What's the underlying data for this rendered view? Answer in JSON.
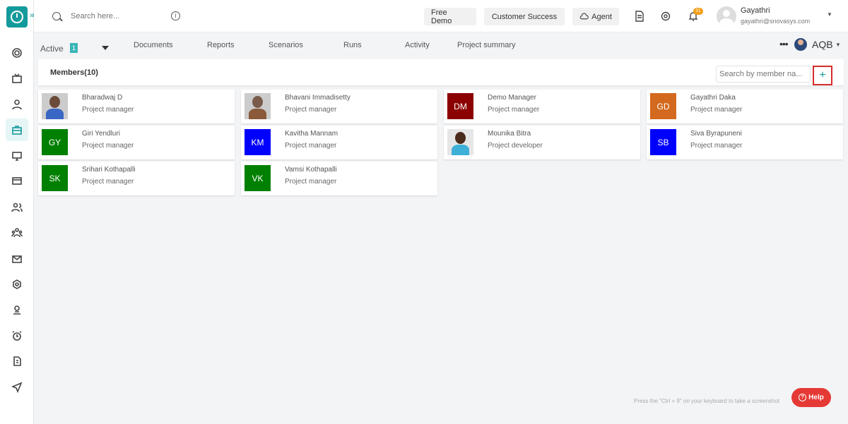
{
  "topbar": {
    "search_placeholder": "Search here...",
    "info_glyph": "i",
    "free_demo": "Free Demo",
    "customer_success": "Customer Success",
    "agent": "Agent",
    "notification_count": "31",
    "user_name": "Gayathri",
    "user_email": "gayathri@snovasys.com"
  },
  "sidebar": {
    "icons": [
      "dashboard-icon",
      "tv-icon",
      "user-icon",
      "briefcase-icon",
      "monitor-icon",
      "card-icon",
      "users-icon",
      "team-icon",
      "mail-icon",
      "settings-icon",
      "profile-icon",
      "alarm-icon",
      "invoice-icon",
      "send-icon"
    ],
    "active": "briefcase-icon"
  },
  "tabs": {
    "status_label": "Active",
    "status_count": "1",
    "items": [
      "Documents",
      "Reports",
      "Scenarios",
      "Runs",
      "Activity",
      "Project summary"
    ],
    "more": "•••",
    "project_code": "AQB"
  },
  "members": {
    "title": "Members(10)",
    "search_placeholder": "Search by member na...",
    "add_label": "+",
    "list": [
      {
        "name": "Bharadwaj D",
        "role": "Project manager",
        "initials": "",
        "color": "",
        "photo": "p1"
      },
      {
        "name": "Bhavani Immadisetty",
        "role": "Project manager",
        "initials": "",
        "color": "",
        "photo": "p2"
      },
      {
        "name": "Demo Manager",
        "role": "Project manager",
        "initials": "DM",
        "color": "#8b0000"
      },
      {
        "name": "Gayathri Daka",
        "role": "Project manager",
        "initials": "GD",
        "color": "#d2691e"
      },
      {
        "name": "Giri Yendluri",
        "role": "Project manager",
        "initials": "GY",
        "color": "#008000"
      },
      {
        "name": "Kavitha Mannam",
        "role": "Project manager",
        "initials": "KM",
        "color": "#0000ff"
      },
      {
        "name": "Mounika Bitra",
        "role": "Project developer",
        "initials": "",
        "color": "",
        "photo": "p3"
      },
      {
        "name": "Siva Byrapuneni",
        "role": "Project manager",
        "initials": "SB",
        "color": "#0000ff"
      },
      {
        "name": "Srihari Kothapalli",
        "role": "Project manager",
        "initials": "SK",
        "color": "#008000"
      },
      {
        "name": "Vamsi Kothapalli",
        "role": "Project manager",
        "initials": "VK",
        "color": "#008000"
      }
    ]
  },
  "hint": "Press the \"Ctrl + 9\" on your keyboard to take a screenshot",
  "help": {
    "label": "Help",
    "glyph": "?"
  },
  "colors": {
    "accent": "#159a9c",
    "help": "#e53935",
    "add_border": "#d62c2c"
  }
}
